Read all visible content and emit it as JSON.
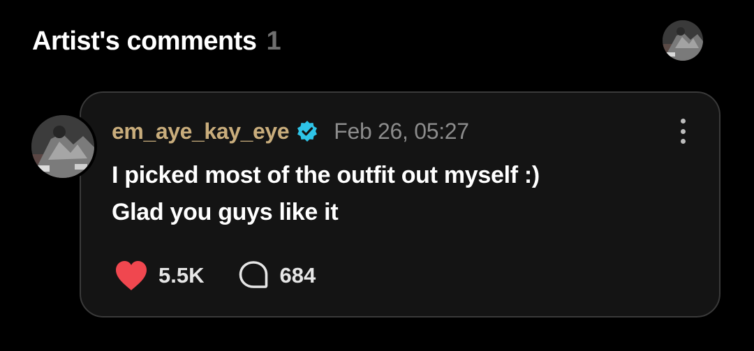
{
  "header": {
    "title": "Artist's comments",
    "count": "1"
  },
  "comment": {
    "username": "em_aye_kay_eye",
    "verified": true,
    "date": "Feb 26, 05:27",
    "lines": [
      "I picked most of the outfit out myself :)",
      "Glad you guys like it"
    ],
    "likes": "5.5K",
    "replies": "684"
  },
  "colors": {
    "background": "#000000",
    "card": "#141414",
    "username": "#c9ad7c",
    "verified_badge": "#2ec4e8",
    "heart": "#f0474f",
    "muted": "#8c8c8c"
  }
}
